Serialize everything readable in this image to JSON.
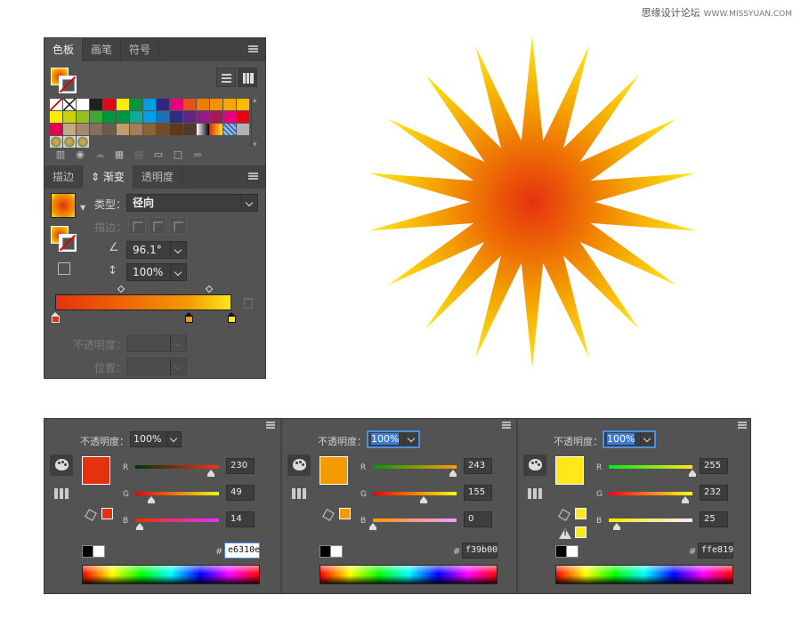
{
  "watermark": {
    "cn": "思缘设计论坛",
    "url": "WWW.MISSYUAN.COM"
  },
  "swatches_panel": {
    "tabs": [
      "色板",
      "画笔",
      "符号"
    ],
    "active_tab": "色板",
    "swatch_colors": [
      "none",
      "#ffffff",
      "#ffffff",
      "#231f20",
      "#e30613",
      "#ffed00",
      "#009640",
      "#009fe3",
      "#312783",
      "#e6007e",
      "#e94e1b",
      "#ef7d00",
      "#f39200",
      "#f7a600",
      "#fbba00",
      "#ffed00",
      "#c8d400",
      "#95c11f",
      "#3aaa35",
      "#009640",
      "#00963f",
      "#13a89e",
      "#009fe3",
      "#1d71b8",
      "#2d2e83",
      "#662483",
      "#951b81",
      "#a3195b",
      "#e6007e",
      "#e30613",
      "#e50051",
      "#c5a982",
      "#a48a6c",
      "#87705a",
      "#6d5c4a",
      "#c69c6d",
      "#a67c52",
      "#8c6239",
      "#754c24",
      "#603813",
      "#4e3b2f",
      "gradient-bw",
      "gradient-oy",
      "gradient-pattern",
      "#b3b3b3",
      "pattern-a",
      "pattern-b",
      "pattern-c"
    ]
  },
  "gradient_panel": {
    "tabs": [
      "描边",
      "渐变",
      "透明度"
    ],
    "active_tab": "渐变",
    "type_label": "类型：",
    "type_value": "径向",
    "stroke_label": "描边：",
    "angle_value": "96.1°",
    "aspect_value": "100%",
    "opacity_label": "不透明度：",
    "location_label": "位置：",
    "stops": [
      {
        "color": "#e6310e",
        "location": 0
      },
      {
        "color": "#f39b00",
        "location": 76
      },
      {
        "color": "#ffe819",
        "location": 100
      }
    ],
    "midpoints": [
      38,
      88
    ]
  },
  "starburst": {
    "points": 18,
    "center_color": "#e6310e",
    "mid_color": "#f39b00",
    "outer_color": "#ffe819"
  },
  "color_panels": [
    {
      "opacity_label": "不透明度：",
      "opacity_value": "100%",
      "opacity_focused": false,
      "swatch": "#e6310e",
      "r": "230",
      "g": "49",
      "b": "14",
      "r_frac": 0.902,
      "g_frac": 0.192,
      "b_frac": 0.055,
      "hex": "e6310e",
      "hex_editing": true,
      "gamut_warning": false
    },
    {
      "opacity_label": "不透明度：",
      "opacity_value": "100%",
      "opacity_focused": true,
      "swatch": "#f39b00",
      "r": "243",
      "g": "155",
      "b": "0",
      "r_frac": 0.953,
      "g_frac": 0.608,
      "b_frac": 0.0,
      "hex": "f39b00",
      "hex_editing": false,
      "gamut_warning": false
    },
    {
      "opacity_label": "不透明度：",
      "opacity_value": "100%",
      "opacity_focused": true,
      "swatch": "#ffe819",
      "r": "255",
      "g": "232",
      "b": "25",
      "r_frac": 1.0,
      "g_frac": 0.91,
      "b_frac": 0.098,
      "hex": "ffe819",
      "hex_editing": false,
      "gamut_warning": true
    }
  ],
  "channel_labels": [
    "R",
    "G",
    "B"
  ],
  "hash_symbol": "#"
}
